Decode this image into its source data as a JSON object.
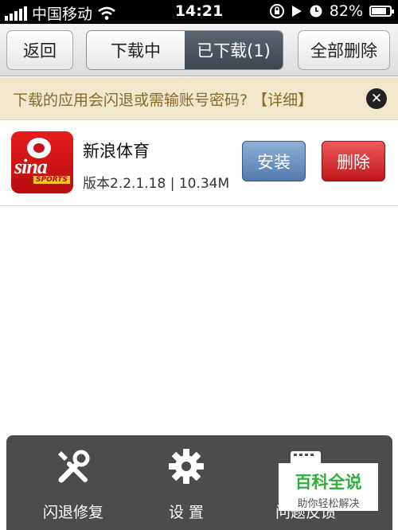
{
  "status_bar": {
    "carrier": "中国移动",
    "time": "14:21",
    "battery": "82%",
    "battery_level": 0.82
  },
  "toolbar": {
    "back_label": "返回",
    "tab_downloading": "下载中",
    "tab_downloaded": "已下载(1)",
    "delete_all_label": "全部删除"
  },
  "notice": {
    "text": "下载的应用会闪退或需输账号密码?",
    "detail_link": "【详细】",
    "close_icon": "close-icon"
  },
  "app": {
    "name": "新浪体育",
    "meta": "版本2.2.1.18 | 10.34M",
    "icon_text": "sina",
    "icon_subtext": "SPORTS",
    "install_label": "安装",
    "delete_label": "删除"
  },
  "bottom_bar": {
    "items": [
      {
        "label": "闪退修复",
        "icon": "tools-icon"
      },
      {
        "label": "设 置",
        "icon": "gear-icon"
      },
      {
        "label": "问题反馈",
        "icon": "feedback-icon"
      }
    ]
  },
  "watermark": {
    "title": "百科全说",
    "subtitle": "助你轻松解决"
  },
  "colors": {
    "install_blue": "#4f7bab",
    "delete_red": "#c1161a",
    "notice_bg": "#f1e7cc",
    "bottom_bar_bg": "#4c4c4c"
  }
}
